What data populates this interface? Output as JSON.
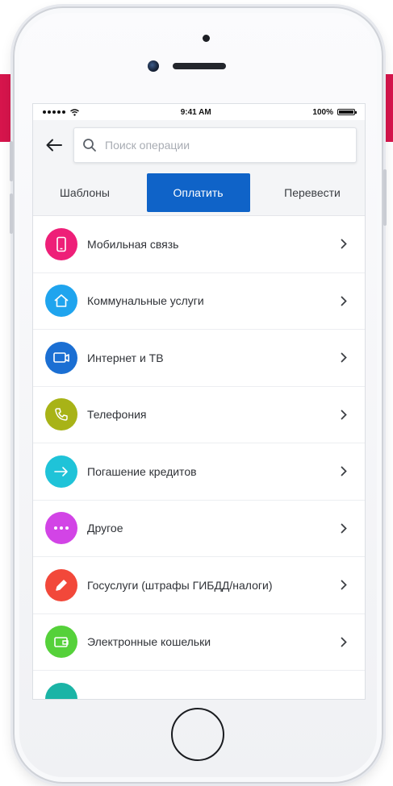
{
  "colors": {
    "accent_banner": "#d6154c",
    "primary_tab": "#0f63c8"
  },
  "status_bar": {
    "time": "9:41 AM",
    "battery": "100%"
  },
  "search": {
    "placeholder": "Поиск операции"
  },
  "tabs": [
    {
      "label": "Шаблоны",
      "active": false
    },
    {
      "label": "Оплатить",
      "active": true
    },
    {
      "label": "Перевести",
      "active": false
    }
  ],
  "list": [
    {
      "label": "Мобильная связь",
      "icon": "mobile-icon",
      "color": "#ee1f78"
    },
    {
      "label": "Коммунальные услуги",
      "icon": "home-icon",
      "color": "#1fa4ee"
    },
    {
      "label": "Интернет и ТВ",
      "icon": "tv-icon",
      "color": "#1b6fd3"
    },
    {
      "label": "Телефония",
      "icon": "phone-icon",
      "color": "#a8b317"
    },
    {
      "label": "Погашение кредитов",
      "icon": "arrow-icon",
      "color": "#1fc3d8"
    },
    {
      "label": "Другое",
      "icon": "dots-icon",
      "color": "#d244e6"
    },
    {
      "label": "Госуслуги (штрафы ГИБДД/налоги)",
      "icon": "pen-icon",
      "color": "#f2483a"
    },
    {
      "label": "Электронные кошельки",
      "icon": "wallet-icon",
      "color": "#55d13a"
    }
  ],
  "partial_item": {
    "icon": "partial-icon",
    "color": "#1bb4a6"
  }
}
